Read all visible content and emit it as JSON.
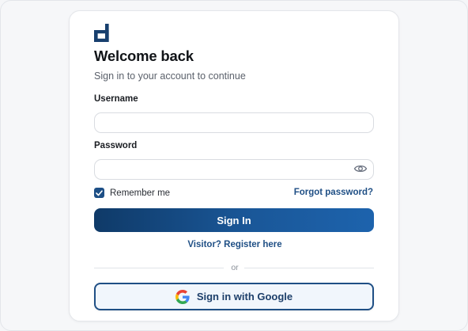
{
  "login": {
    "title": "Welcome back",
    "subtitle": "Sign in to your account to continue",
    "username_label": "Username",
    "username_value": "",
    "password_label": "Password",
    "password_value": "",
    "remember_label": "Remember me",
    "remember_checked": true,
    "forgot_label": "Forgot password?",
    "signin_label": "Sign In",
    "register_label": "Visitor? Register here",
    "divider_text": "or",
    "google_label": "Sign in with Google"
  },
  "icons": {
    "logo": "brand-d-logo-icon",
    "eye": "eye-icon",
    "check": "check-icon",
    "google": "google-icon"
  },
  "colors": {
    "brand": "#1d4f86",
    "button_gradient_start": "#0f3a68",
    "button_gradient_end": "#1d63ad",
    "link": "#1f4f85"
  }
}
